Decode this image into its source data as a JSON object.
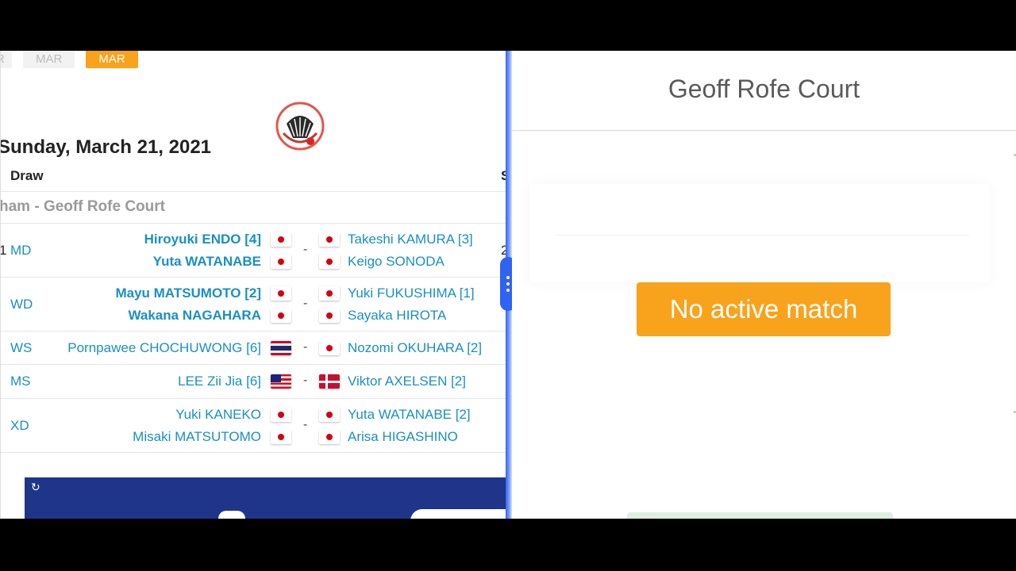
{
  "date_tabs": [
    {
      "label": "R",
      "active": false
    },
    {
      "label": "MAR",
      "active": false
    },
    {
      "label": "MAR",
      "active": true
    }
  ],
  "schedule": {
    "day_title": "Sunday, March 21, 2021",
    "column_draw": "Draw",
    "column_score_cut": "S",
    "court_label": "ham - Geoff Rofe Court",
    "matches": [
      {
        "event": "MD",
        "num": "1",
        "score_cut": "2",
        "left": [
          {
            "name": "Hiroyuki ENDO [4]",
            "flag": "jp"
          },
          {
            "name": "Yuta WATANABE",
            "flag": "jp"
          }
        ],
        "right": [
          {
            "name": "Takeshi KAMURA [3]",
            "flag": "jp"
          },
          {
            "name": "Keigo SONODA",
            "flag": "jp"
          }
        ],
        "winner": "left"
      },
      {
        "event": "WD",
        "left": [
          {
            "name": "Mayu MATSUMOTO [2]",
            "flag": "jp"
          },
          {
            "name": "Wakana NAGAHARA",
            "flag": "jp"
          }
        ],
        "right": [
          {
            "name": "Yuki FUKUSHIMA [1]",
            "flag": "jp"
          },
          {
            "name": "Sayaka HIROTA",
            "flag": "jp"
          }
        ],
        "winner": "left"
      },
      {
        "event": "WS",
        "left": [
          {
            "name": "Pornpawee CHOCHUWONG [6]",
            "flag": "th"
          }
        ],
        "right": [
          {
            "name": "Nozomi OKUHARA [2]",
            "flag": "jp"
          }
        ],
        "winner": ""
      },
      {
        "event": "MS",
        "left": [
          {
            "name": "LEE Zii Jia [6]",
            "flag": "my"
          }
        ],
        "right": [
          {
            "name": "Viktor AXELSEN [2]",
            "flag": "dk"
          }
        ],
        "winner": ""
      },
      {
        "event": "XD",
        "left": [
          {
            "name": "Yuki KANEKO",
            "flag": "jp"
          },
          {
            "name": "Misaki MATSUTOMO",
            "flag": "jp"
          }
        ],
        "right": [
          {
            "name": "Yuta WATANABE [2]",
            "flag": "jp"
          },
          {
            "name": "Arisa HIGASHINO",
            "flag": "jp"
          }
        ],
        "winner": ""
      }
    ],
    "dash": "-"
  },
  "court_panel": {
    "title": "Geoff Rofe Court",
    "status": "No active match"
  },
  "colors": {
    "accent_orange": "#f9a21b",
    "link_blue": "#1a8fc5",
    "splitter_blue": "#2f63f5",
    "banner_navy": "#1f3589"
  },
  "icons": {
    "logo": "shuttlecock-logo-icon",
    "banner": "refresh-icon",
    "splitter": "drag-handle-icon"
  }
}
